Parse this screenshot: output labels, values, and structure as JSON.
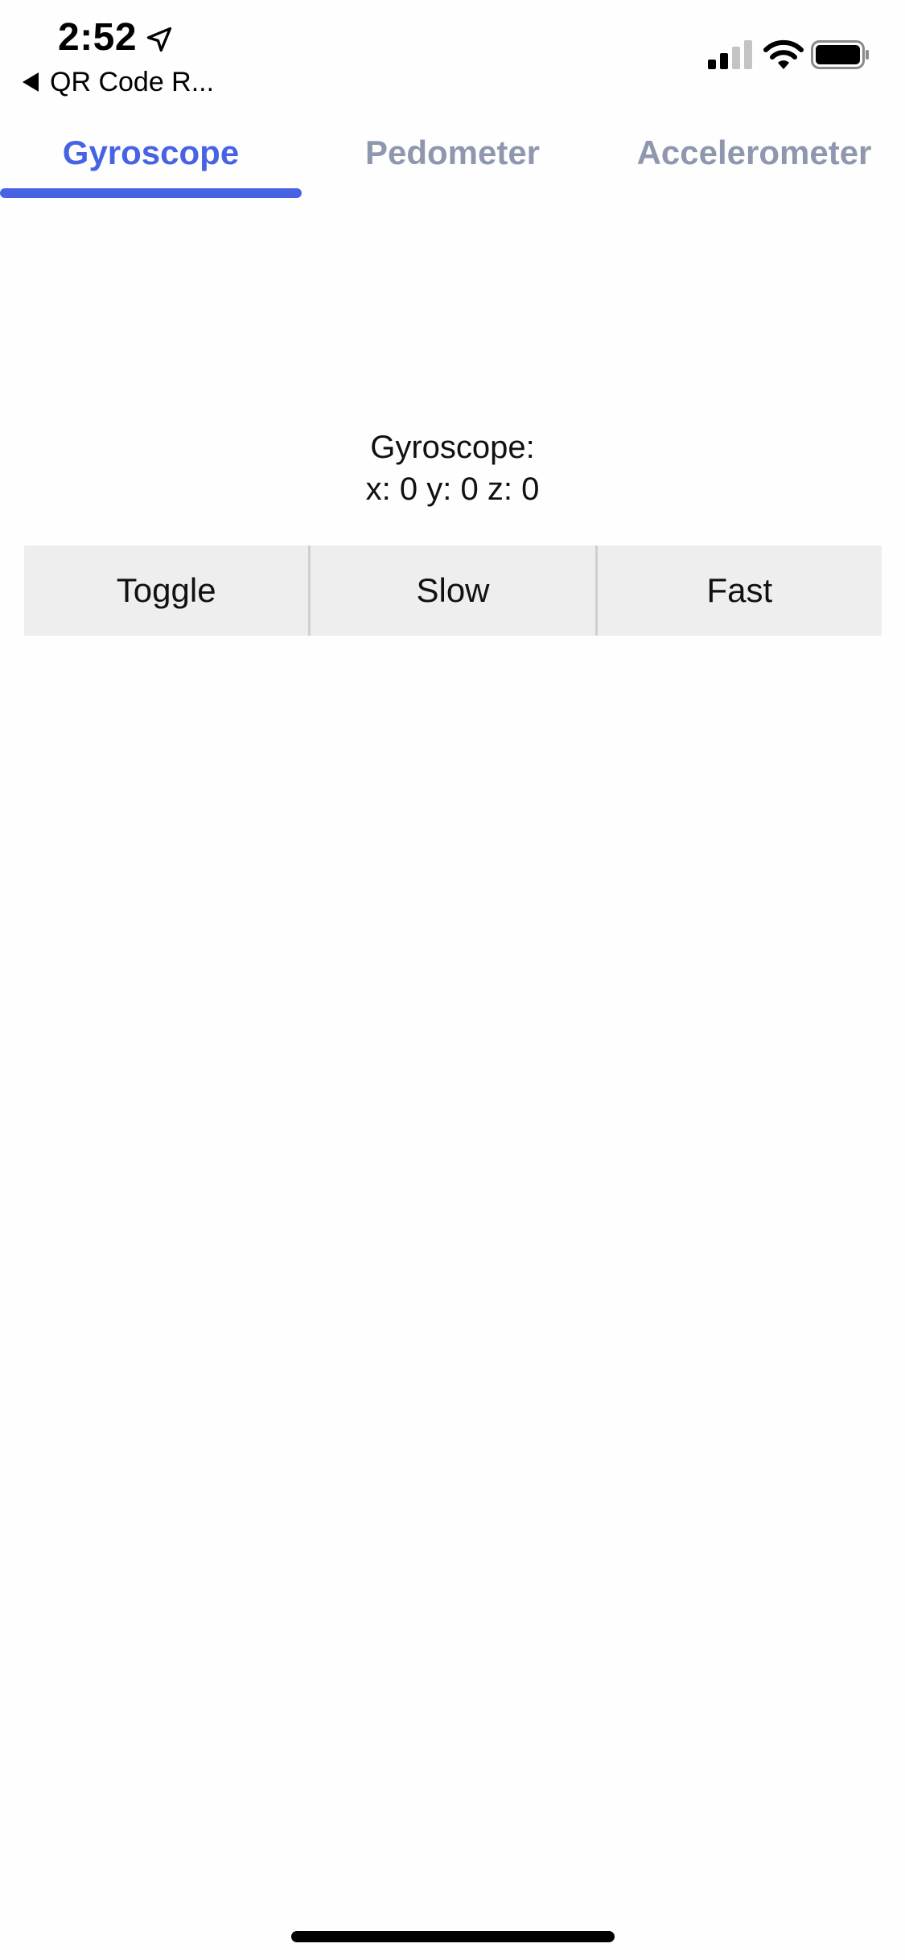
{
  "status_bar": {
    "time": "2:52",
    "back_label": "QR Code R...",
    "icons": [
      "location-arrow-icon",
      "cellular-signal-icon",
      "wifi-icon",
      "battery-icon"
    ]
  },
  "tabs": [
    {
      "label": "Gyroscope",
      "active": true
    },
    {
      "label": "Pedometer",
      "active": false
    },
    {
      "label": "Accelerometer",
      "active": false
    }
  ],
  "readout": {
    "title": "Gyroscope:",
    "values": "x: 0 y: 0 z: 0"
  },
  "buttons": {
    "toggle": "Toggle",
    "slow": "Slow",
    "fast": "Fast"
  },
  "colors": {
    "accent": "#4763e4",
    "inactive_tab": "#8e97ad",
    "button_bg": "#eeeeee"
  }
}
